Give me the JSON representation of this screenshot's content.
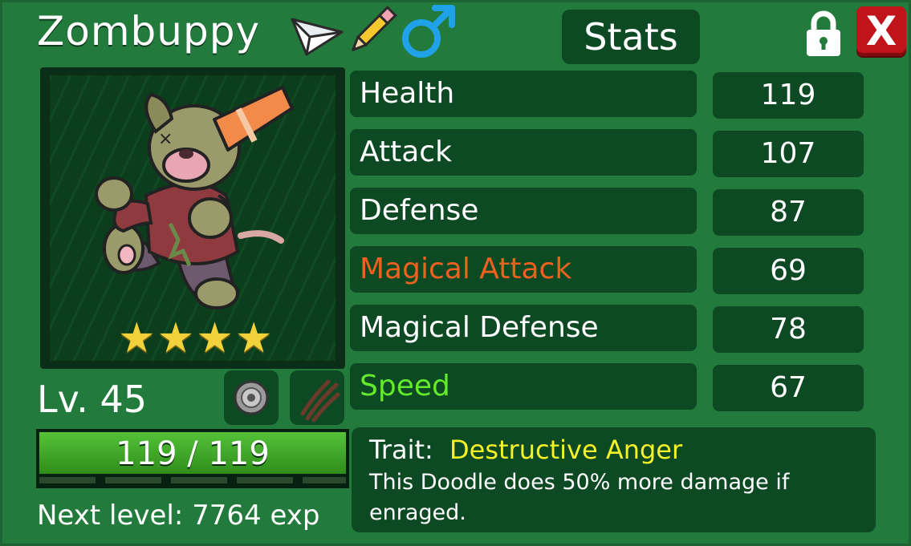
{
  "creature": {
    "name": "Zombuppy",
    "level_label": "Lv. 45",
    "stars": 4,
    "hp_text": "119 / 119",
    "hp_fraction": 1.0,
    "next_level_text": "Next level: 7764 exp"
  },
  "header": {
    "stats_label": "Stats",
    "close_label": "X"
  },
  "icons": {
    "rename": "paper-plane-icon",
    "edit": "pencil-icon",
    "gender": "male-symbol-icon",
    "lock": "lock-icon",
    "held_item": "disc-item-icon",
    "ability": "claw-marks-icon"
  },
  "stats": [
    {
      "label": "Health",
      "value": "119",
      "color": "#ffffff"
    },
    {
      "label": "Attack",
      "value": "107",
      "color": "#ffffff"
    },
    {
      "label": "Defense",
      "value": "87",
      "color": "#ffffff"
    },
    {
      "label": "Magical Attack",
      "value": "69",
      "color": "#f0601e"
    },
    {
      "label": "Magical Defense",
      "value": "78",
      "color": "#ffffff"
    },
    {
      "label": "Speed",
      "value": "67",
      "color": "#63ea2a"
    }
  ],
  "trait": {
    "prefix": "Trait:",
    "name": "Destructive Anger",
    "name_color": "#f5f227",
    "description": "This Doodle does 50% more damage if enraged."
  },
  "colors": {
    "panel": "#237a3d",
    "box": "#0d4a24",
    "close": "#c0141a",
    "star": "#f2d23a",
    "male": "#1fa2e8"
  }
}
